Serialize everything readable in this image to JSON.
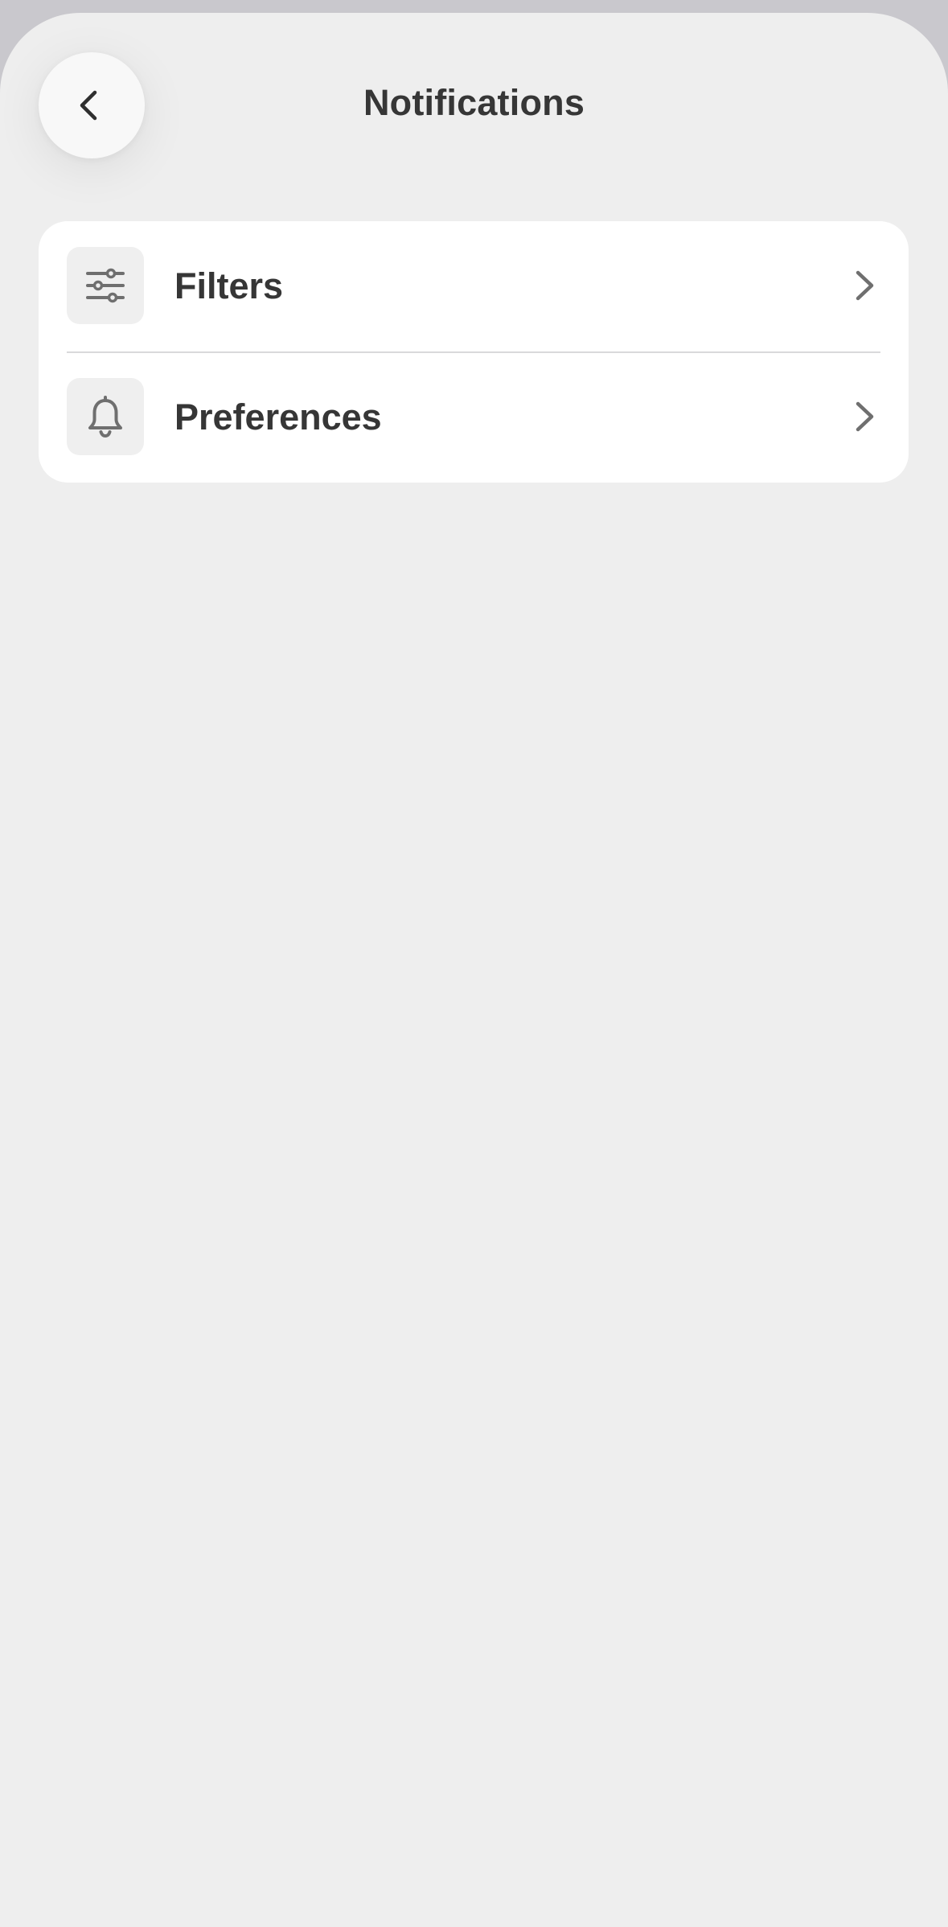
{
  "header": {
    "title": "Notifications",
    "back_icon": "chevron-left-icon"
  },
  "menu": {
    "items": [
      {
        "label": "Filters",
        "icon": "sliders-icon",
        "trailing_icon": "chevron-right-icon"
      },
      {
        "label": "Preferences",
        "icon": "bell-icon",
        "trailing_icon": "chevron-right-icon"
      }
    ]
  },
  "colors": {
    "background": "#eeeeee",
    "card": "#ffffff",
    "text": "#363636",
    "icon": "#6f6f6f",
    "icon_box": "#efefef",
    "divider": "#d9d9db"
  }
}
